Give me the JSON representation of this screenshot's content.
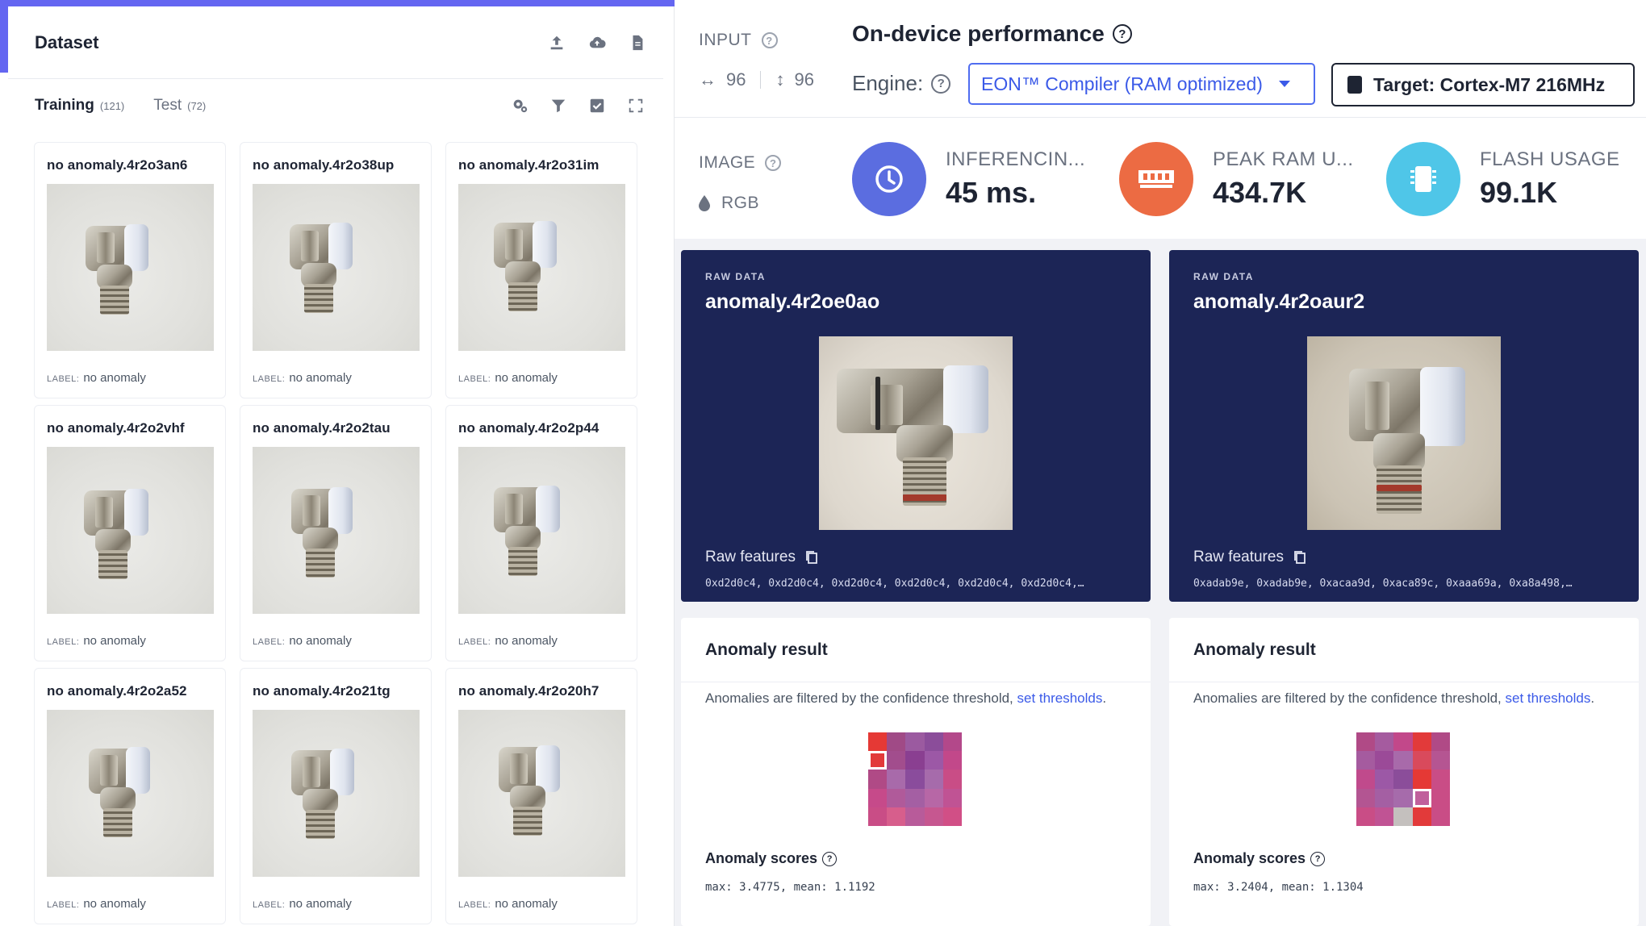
{
  "dataset": {
    "title": "Dataset",
    "header_icons": [
      "upload-icon",
      "cloud-upload-icon",
      "document-icon"
    ],
    "tabs": [
      {
        "label": "Training",
        "count": "(121)",
        "active": true
      },
      {
        "label": "Test",
        "count": "(72)",
        "active": false
      }
    ],
    "tab_icons": [
      "settings-filter-icon",
      "filter-icon",
      "checkbox-icon",
      "expand-icon"
    ],
    "label_key": "LABEL:",
    "samples": [
      {
        "name": "no anomaly.4r2o3an6",
        "label": "no anomaly"
      },
      {
        "name": "no anomaly.4r2o38up",
        "label": "no anomaly"
      },
      {
        "name": "no anomaly.4r2o31im",
        "label": "no anomaly"
      },
      {
        "name": "no anomaly.4r2o2vhf",
        "label": "no anomaly"
      },
      {
        "name": "no anomaly.4r2o2tau",
        "label": "no anomaly"
      },
      {
        "name": "no anomaly.4r2o2p44",
        "label": "no anomaly"
      },
      {
        "name": "no anomaly.4r2o2a52",
        "label": "no anomaly"
      },
      {
        "name": "no anomaly.4r2o21tg",
        "label": "no anomaly"
      },
      {
        "name": "no anomaly.4r2o20h7",
        "label": "no anomaly"
      }
    ]
  },
  "input": {
    "label": "INPUT",
    "width": "96",
    "height": "96",
    "image_label": "IMAGE",
    "color_mode": "RGB"
  },
  "performance": {
    "title": "On-device performance",
    "engine_label": "Engine:",
    "engine_value": "EON™ Compiler (RAM optimized)",
    "target": "Target: Cortex-M7 216MHz",
    "metrics": [
      {
        "label": "INFERENCIN...",
        "value": "45 ms.",
        "color": "#5b6de0",
        "icon": "clock-icon"
      },
      {
        "label": "PEAK RAM U...",
        "value": "434.7K",
        "color": "#ec6b43",
        "icon": "ram-icon"
      },
      {
        "label": "FLASH USAGE",
        "value": "99.1K",
        "color": "#4fc6e8",
        "icon": "chip-icon"
      }
    ]
  },
  "raw_cards": [
    {
      "tag": "RAW DATA",
      "name": "anomaly.4r2oe0ao",
      "features_label": "Raw features",
      "features": "0xd2d0c4, 0xd2d0c4, 0xd2d0c4, 0xd2d0c4, 0xd2d0c4, 0xd2d0c4,…"
    },
    {
      "tag": "RAW DATA",
      "name": "anomaly.4r2oaur2",
      "features_label": "Raw features",
      "features": "0xadab9e, 0xadab9e, 0xacaa9d, 0xaca89c, 0xaaa69a, 0xa8a498,…"
    }
  ],
  "anomaly_cards": [
    {
      "title": "Anomaly result",
      "desc": "Anomalies are filtered by the confidence threshold, ",
      "link": "set thresholds",
      "desc_end": ".",
      "scores_label": "Anomaly scores",
      "scores": "max: 3.4775, mean: 1.1192",
      "heatmap": [
        [
          "#e53935",
          "#a04a86",
          "#9b5aa0",
          "#8b4d9a",
          "#b3488a"
        ],
        [
          "#e23a3a",
          "#a24d8d",
          "#8a3f91",
          "#9c58a6",
          "#c2488a"
        ],
        [
          "#b04a86",
          "#a86aaa",
          "#8a4c9c",
          "#a66bab",
          "#c94d86"
        ],
        [
          "#c64a8a",
          "#b05a9a",
          "#a45fa3",
          "#b767a6",
          "#c05394"
        ],
        [
          "#c94d86",
          "#d75e8c",
          "#b85b9a",
          "#c65790",
          "#d14f86"
        ]
      ],
      "highlight_cell": [
        1,
        0
      ]
    },
    {
      "title": "Anomaly result",
      "desc": "Anomalies are filtered by the confidence threshold, ",
      "link": "set thresholds",
      "desc_end": ".",
      "scores_label": "Anomaly scores",
      "scores": "max: 3.2404, mean: 1.1304",
      "heatmap": [
        [
          "#b04a86",
          "#a55b9f",
          "#c2488a",
          "#e23a3a",
          "#b04a86"
        ],
        [
          "#a55b9f",
          "#9b4a98",
          "#a86aaa",
          "#d94a5c",
          "#b55592"
        ],
        [
          "#c04a8c",
          "#9c58a6",
          "#8b4d9a",
          "#e53935",
          "#c94d86"
        ],
        [
          "#b35592",
          "#a45fa3",
          "#a66bab",
          "#c0609c",
          "#c94d86"
        ],
        [
          "#c94d86",
          "#c05394",
          "#c4c0be",
          "#e23a3a",
          "#c94d86"
        ]
      ],
      "highlight_cell": [
        3,
        3
      ]
    }
  ]
}
